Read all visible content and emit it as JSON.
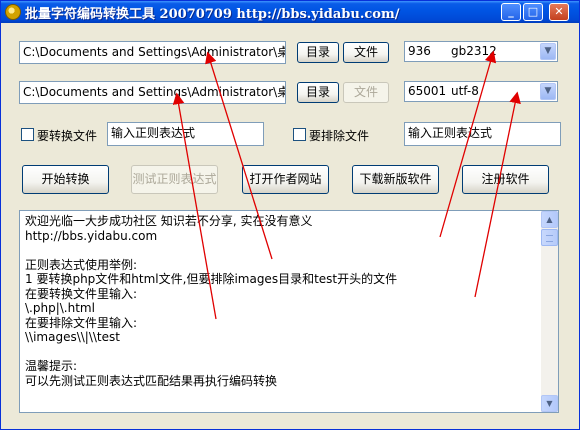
{
  "window": {
    "title": "批量字符编码转换工具 20070709 http://bbs.yidabu.com/",
    "minimize_glyph": "_",
    "maximize_glyph": "□",
    "close_glyph": "✕"
  },
  "row1": {
    "path": "C:\\Documents and Settings\\Administrator\\桌面\\",
    "dir_button": "目录",
    "file_button": "文件",
    "encoding_code": "936",
    "encoding_name": "gb2312"
  },
  "row2": {
    "path": "C:\\Documents and Settings\\Administrator\\桌面\\",
    "dir_button": "目录",
    "file_button": "文件",
    "encoding_code": "65001",
    "encoding_name": "utf-8"
  },
  "filters": {
    "convert_label": "要转换文件",
    "convert_placeholder": "输入正则表达式",
    "exclude_label": "要排除文件",
    "exclude_placeholder": "输入正则表达式"
  },
  "actions": {
    "start": "开始转换",
    "test_regex": "测试正则表达式",
    "open_author_site": "打开作者网站",
    "download_new": "下载新版软件",
    "register": "注册软件"
  },
  "memo": {
    "lines": [
      "欢迎光临一大步成功社区 知识若不分享, 实在没有意义",
      "http://bbs.yidabu.com",
      "",
      "正则表达式使用举例:",
      "1 要转换php文件和html文件,但要排除images目录和test开头的文件",
      "在要转换文件里输入:",
      "\\.php|\\.html",
      "在要排除文件里输入:",
      "\\\\images\\\\|\\\\test",
      "",
      "温馨提示:",
      "可以先测试正则表达式匹配结果再执行编码转换"
    ]
  },
  "colors": {
    "titlebar": "#0054e3",
    "window_bg": "#ece9d8",
    "arrow": "#e00000"
  }
}
